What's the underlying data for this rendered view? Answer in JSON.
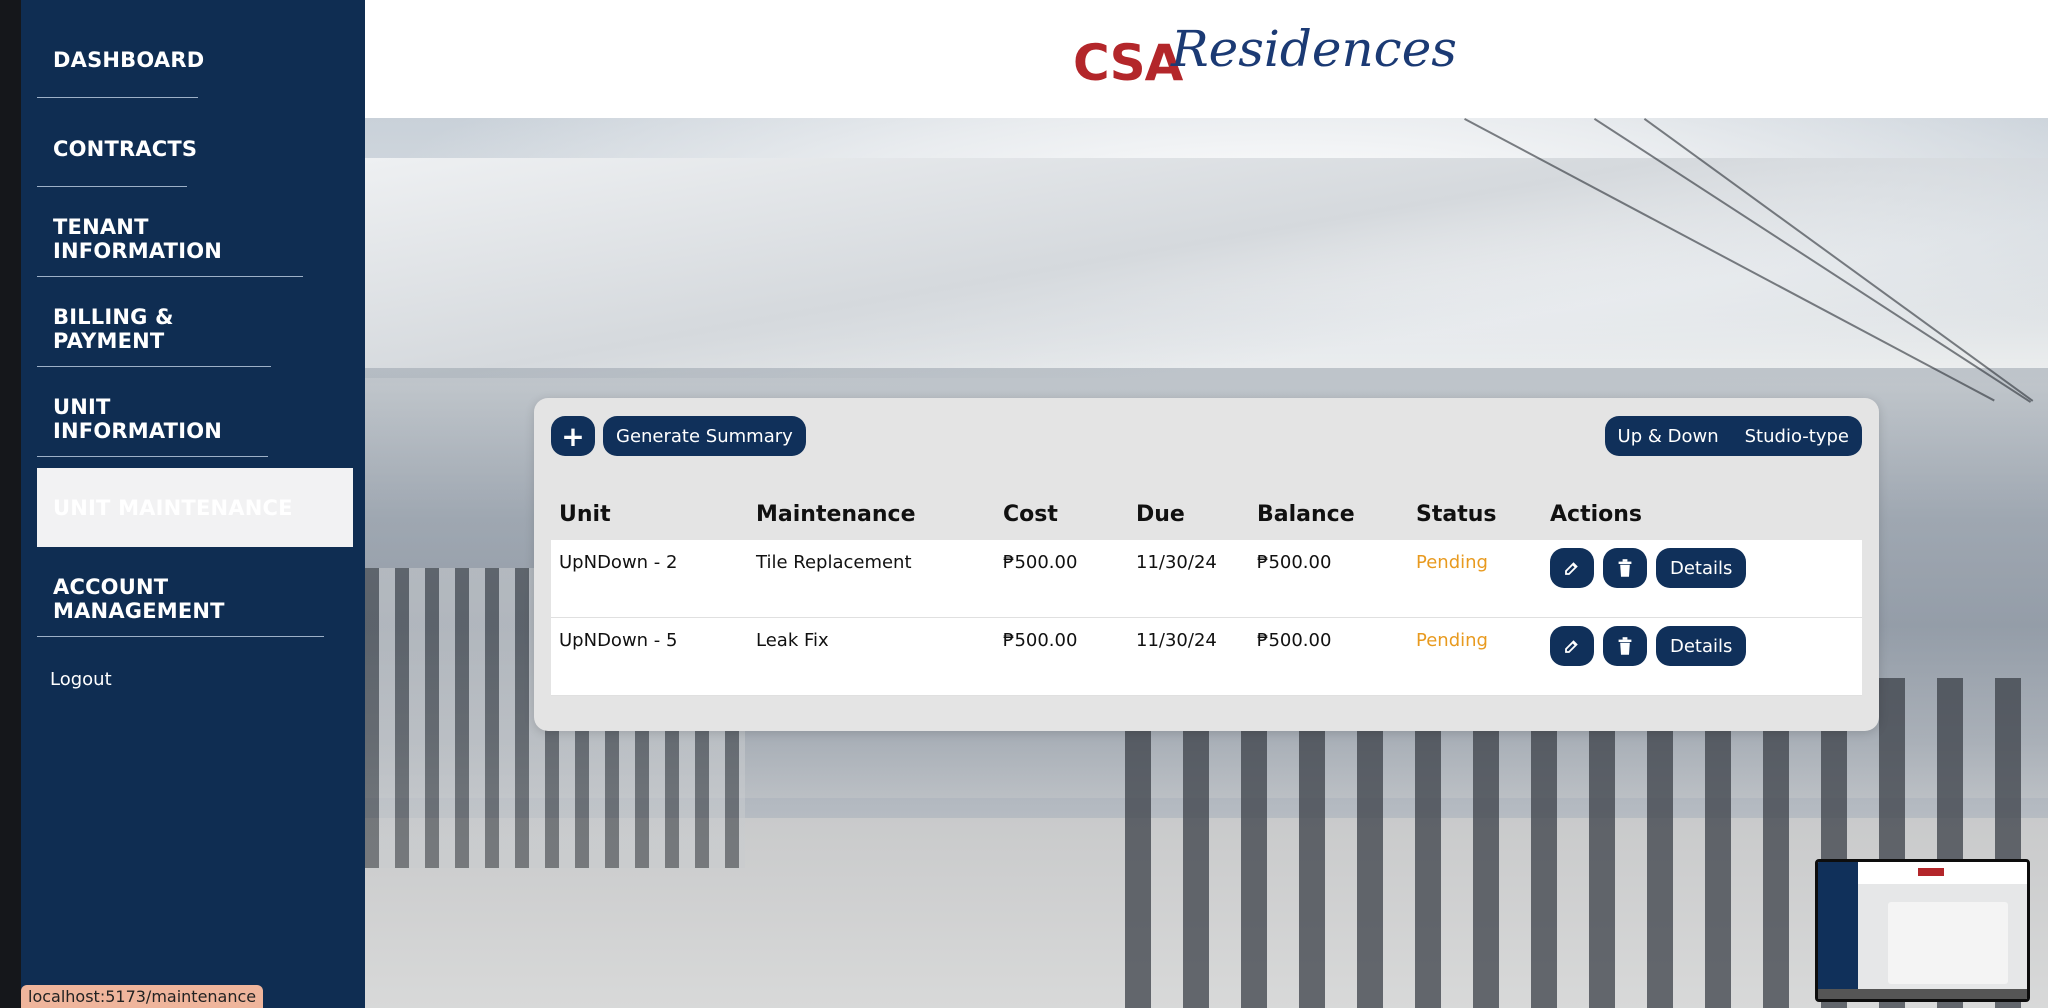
{
  "app": {
    "brand_primary": "CSA",
    "brand_script": "Residences",
    "colors": {
      "navy": "#0f2d52",
      "brand_red": "#b3262a",
      "pending": "#e89a1f"
    }
  },
  "sidebar": {
    "items": [
      {
        "label": "DASHBOARD",
        "active": false
      },
      {
        "label": "CONTRACTS",
        "active": false
      },
      {
        "label": "TENANT INFORMATION",
        "active": false
      },
      {
        "label": "BILLING & PAYMENT",
        "active": false
      },
      {
        "label": "UNIT INFORMATION",
        "active": false
      },
      {
        "label": "UNIT MAINTENANCE",
        "active": true
      },
      {
        "label": "ACCOUNT MANAGEMENT",
        "active": false
      }
    ],
    "logout_label": "Logout"
  },
  "toolbar": {
    "add_icon": "plus-icon",
    "add_label": "+",
    "summary_label": "Generate Summary",
    "filters": [
      "Up & Down",
      "Studio-type"
    ]
  },
  "table": {
    "headers": [
      "Unit",
      "Maintenance",
      "Cost",
      "Due",
      "Balance",
      "Status",
      "Actions"
    ],
    "rows": [
      {
        "unit": "UpNDown - 2",
        "maintenance": "Tile Replacement",
        "cost": "₱500.00",
        "due": "11/30/24",
        "balance": "₱500.00",
        "status": "Pending",
        "details_label": "Details"
      },
      {
        "unit": "UpNDown - 5",
        "maintenance": "Leak Fix",
        "cost": "₱500.00",
        "due": "11/30/24",
        "balance": "₱500.00",
        "status": "Pending",
        "details_label": "Details"
      }
    ],
    "action_icons": [
      "edit-icon",
      "trash-icon"
    ]
  },
  "statusbar": {
    "url": "localhost:5173/maintenance"
  }
}
